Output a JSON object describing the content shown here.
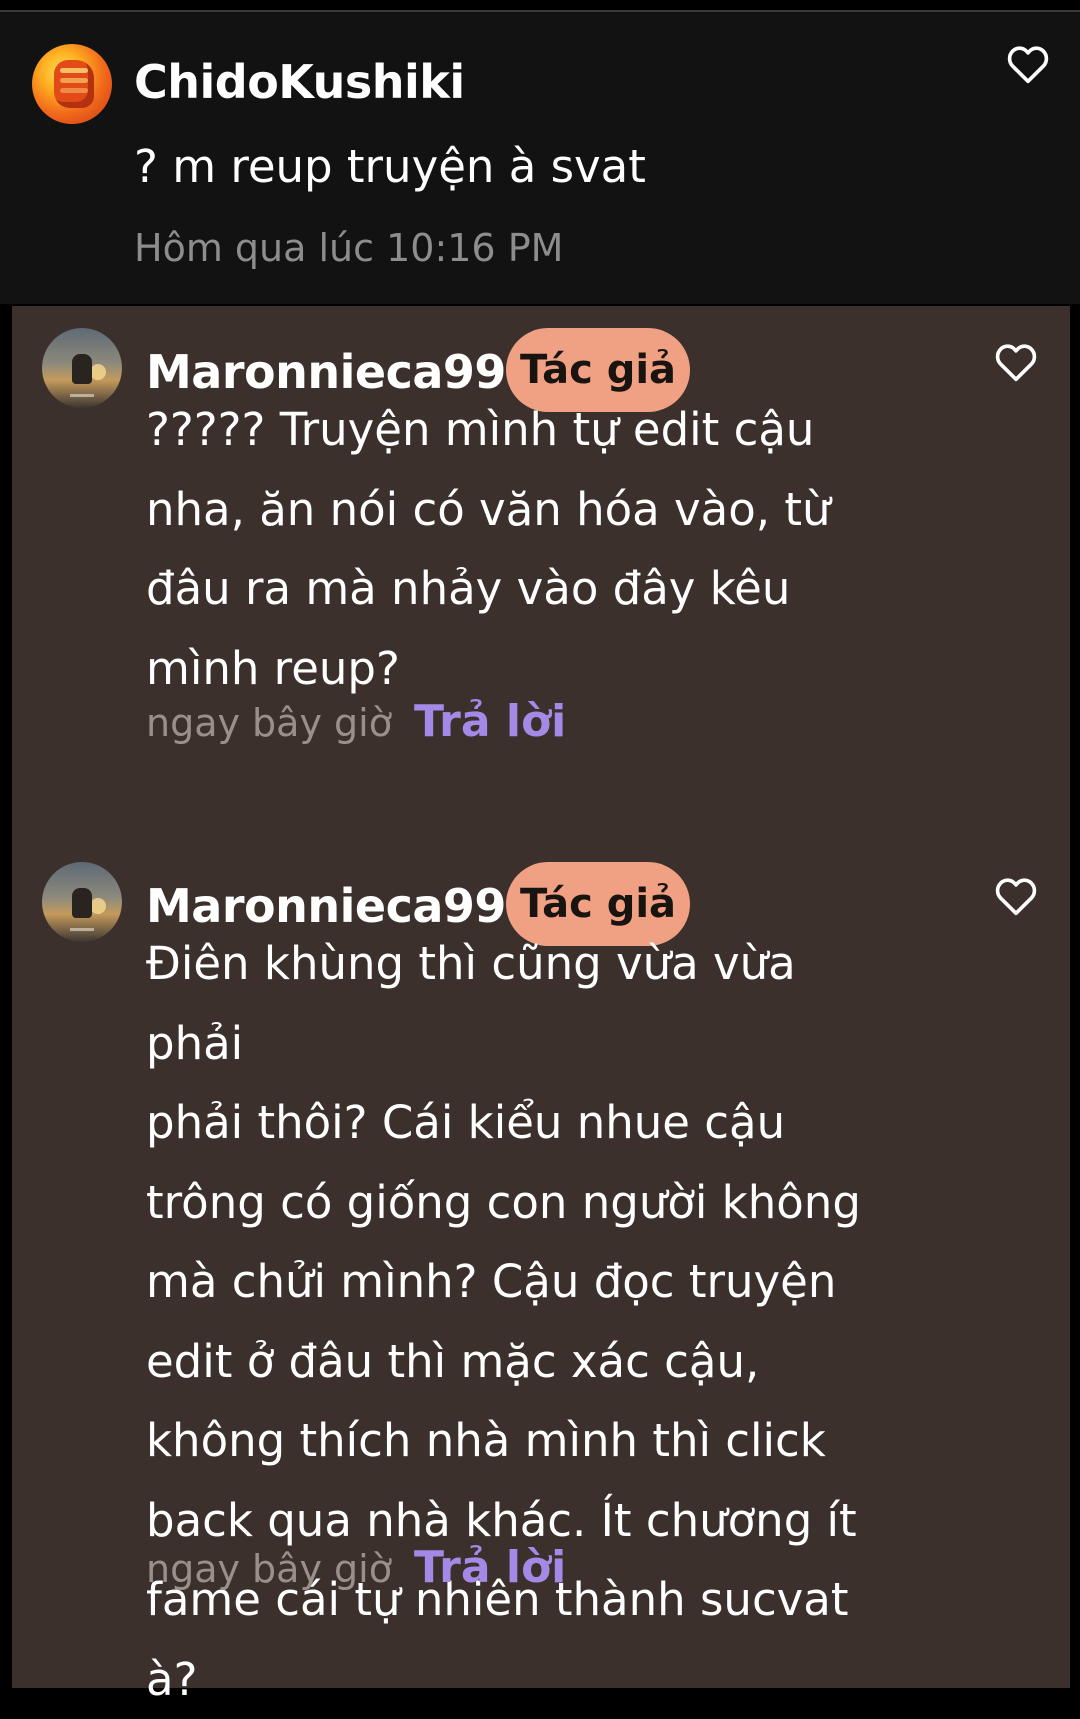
{
  "main_comment": {
    "username": "ChidoKushiki",
    "text": "? m reup truyện à svat",
    "timestamp": "Hôm qua lúc 10:16 PM",
    "avatar_icon": "raised-fist-avatar",
    "like_icon": "heart-outline-icon"
  },
  "replies": [
    {
      "username": "Maronnieca99",
      "badge": "Tác giả",
      "text": "????? Truyện mình tự edit cậu\nnha, ăn nói có văn hóa vào, từ\nđâu ra mà nhảy vào đây kêu\nmình reup?",
      "time": "ngay bây giờ",
      "reply_label": "Trả lời",
      "avatar_icon": "anime-scene-avatar",
      "like_icon": "heart-outline-icon"
    },
    {
      "username": "Maronnieca99",
      "badge": "Tác giả",
      "text": "Điên khùng thì cũng vừa vừa phải\nphải thôi? Cái kiểu nhue cậu\ntrông có giống con người không\nmà chửi mình? Cậu đọc truyện\nedit ở đâu thì mặc xác cậu,\nkhông thích nhà mình thì click\nback qua nhà khác. Ít chương ít\nfame cái tự nhiên thành sucvat à?",
      "time": "ngay bây giờ",
      "reply_label": "Trả lời",
      "avatar_icon": "anime-scene-avatar",
      "like_icon": "heart-outline-icon"
    }
  ],
  "colors": {
    "background": "#000000",
    "main_comment_bg": "#121212",
    "replies_bg": "#3b302c",
    "badge_bg": "#f0a083",
    "reply_link": "#a48ae6",
    "muted_text": "#8d8d8d"
  }
}
